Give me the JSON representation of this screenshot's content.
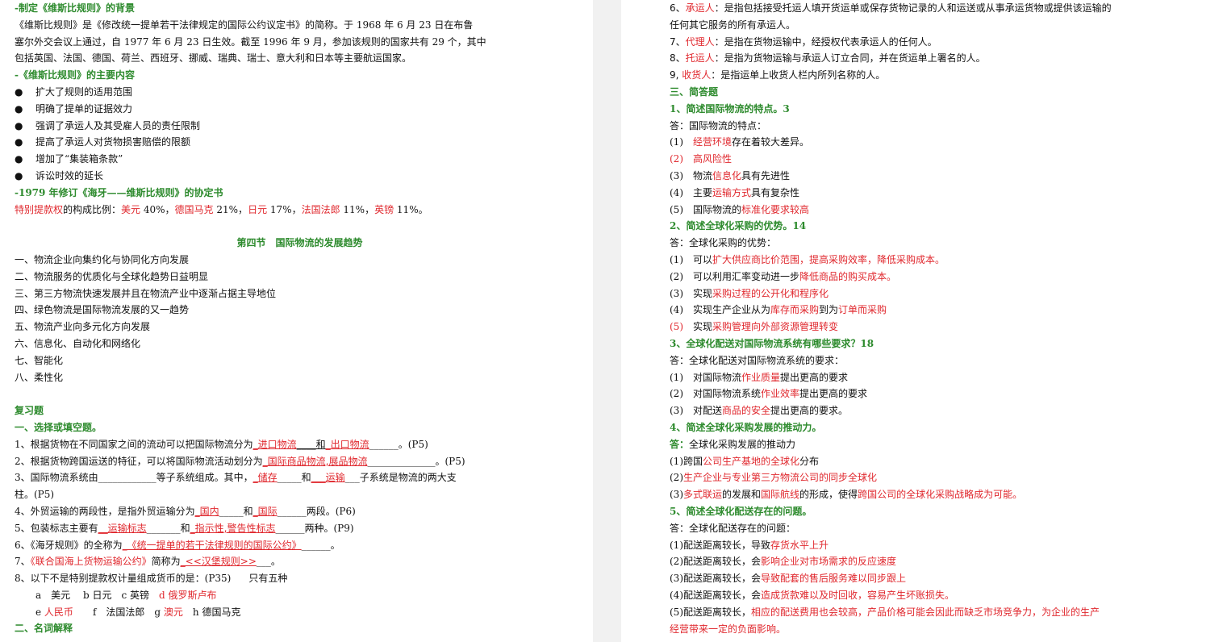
{
  "left": {
    "l1": "-制定《维斯比规则》的背景",
    "l2": "《维斯比规则》是《修改统一提单若干法律规定的国际公约议定书》的简称。于 1968 年 6 月 23 日在布鲁",
    "l3": "塞尔外交会议上通过，自 1977 年 6 月 23 日生效。截至 1996 年 9 月，参加该规则的国家共有 29 个，其中",
    "l4": "包括英国、法国、德国、荷兰、西班牙、挪威、瑞典、瑞士、意大利和日本等主要航运国家。",
    "l5": "-《维斯比规则》的主要内容",
    "bullets": [
      "扩大了规则的适用范围",
      "明确了提单的证据效力",
      "强调了承运人及其受雇人员的责任限制",
      "提高了承运人对货物损害赔偿的限额",
      "增加了“集装箱条款”",
      "诉讼时效的延长"
    ],
    "bullet_symbol": "●",
    "l12": "-1979 年修订《海牙——维斯比规则》的协定书",
    "sdr": {
      "a": "特别提款权",
      "b": "的构成比例：",
      "c": "美元",
      "d": " 40%，",
      "e": "德国马克",
      "f": " 21%，",
      "g": "日元",
      "h": " 17%，",
      "i": "法国法郎",
      "j": " 11%，",
      "k": "英镑",
      "m": " 11%。"
    },
    "section": "第四节　国际物流的发展趋势",
    "trends": [
      "一、物流企业向集约化与协同化方向发展",
      "二、物流服务的优质化与全球化趋势日益明显",
      "三、第三方物流快速发展并且在物流产业中逐渐占据主导地位",
      "四、绿色物流是国际物流发展的又一趋势",
      "五、物流产业向多元化方向发展",
      "六、信息化、自动化和网络化",
      "七、智能化",
      "八、柔性化"
    ],
    "review": "复习题",
    "q_title": "一、选择或填空题。",
    "q1": {
      "a": "1、根据货物在不同国家之间的流动可以把国际物流分为",
      "b": "_进口物流",
      "c": "____和",
      "d": "_出口物流",
      "e": "______。(P5)"
    },
    "q2": {
      "a": "2、根据货物跨国运送的特征，可以将国际物流活动划分为",
      "b": "_国际商品物流,展品物流",
      "c": "______________。(P5)"
    },
    "q3": {
      "a": "3、国际物流系统由____________等子系统组成。其中，",
      "b": "_储存",
      "c": "_____和",
      "d": "___运输",
      "e": "___子系统是物流的两大支"
    },
    "q3b": "柱。(P5)",
    "q4": {
      "a": "4、外贸运输的两段性，是指外贸运输分为",
      "b": "_国内",
      "c": "_____和",
      "d": "_国际",
      "e": "______两段。(P6)"
    },
    "q5": {
      "a": "5、包装标志主要有",
      "b": "__运输标志",
      "c": "_______和",
      "d": "_指示性,警告性标志",
      "e": "______两种。(P9)"
    },
    "q6": {
      "a": "6、《海牙规则》的全称为",
      "b": "_《统一提单的若干法律规则的国际公约》",
      "c": "______。"
    },
    "q7": {
      "a": "7、",
      "b": "《联合国海上货物运输公约》",
      "c": "简称为",
      "d": "_<<汉堡规则>>",
      "e": "___。"
    },
    "q8": {
      "a": "8、以下不是特别提款权计量组成货币的是：(P35)",
      "b": "只有五种"
    },
    "q8o1": {
      "a": "a　美元　 b 日元　c 英镑　",
      "b": "d 俄罗斯卢布"
    },
    "q8o2": {
      "a": "e ",
      "b": "人民币",
      "c": "　　f　法国法郎　g ",
      "d": "澳元",
      "e": "　h 德国马克"
    },
    "terms": "二、名词解释"
  },
  "right": {
    "d6": {
      "a": "6、",
      "b": "承运人",
      "c": "：是指包括接受托运人填开货运单或保存货物记录的人和运送或从事承运货物或提供该运输的"
    },
    "d6b": "任何其它服务的所有承运人。",
    "d7": {
      "a": "7、",
      "b": "代理人",
      "c": "：是指在货物运输中，经授权代表承运人的任何人。"
    },
    "d8": {
      "a": "8、",
      "b": "托运人",
      "c": "：是指为货物运输与承运人订立合同，并在货运单上署名的人。"
    },
    "d9": {
      "a": "9, ",
      "b": "收货人",
      "c": "：是指运单上收货人栏内所列名称的人。"
    },
    "short": "三、简答题",
    "s1": {
      "title": "1、简述国际物流的特点。3",
      "ans": "答：国际物流的特点：",
      "i1": {
        "n": "(1)　",
        "a": "经营环境",
        "b": "存在着较大差异。"
      },
      "i2": {
        "n": "(2)　",
        "a": "高风险性"
      },
      "i3": {
        "n": "(3)　",
        "a": "物流",
        "b": "信息化",
        "c": "具有先进性"
      },
      "i4": {
        "n": "(4)　",
        "a": "主要",
        "b": "运输方式",
        "c": "具有复杂性"
      },
      "i5": {
        "n": "(5)　",
        "a": "国际物流的",
        "b": "标准化要求较高"
      }
    },
    "s2": {
      "title": "2、简述全球化采购的优势。14",
      "ans": "答：全球化采购的优势：",
      "i1": {
        "n": "(1)　",
        "a": "可以",
        "b": "扩大供应商比价范围，提高采购效率，降低采购成本。"
      },
      "i2": {
        "n": "(2)　",
        "a": "可以利用汇率变动进一步",
        "b": "降低商品的购买成本。"
      },
      "i3": {
        "n": "(3)　",
        "a": "实现",
        "b": "采购过程的公开化和程序化"
      },
      "i4": {
        "n": "(4)　",
        "a": "实现生产企业从为",
        "b": "库存而采购",
        "c": "到为",
        "d": "订单而采购"
      },
      "i5": {
        "n": "(5)　",
        "a": "实现",
        "b": "采购管理向外部资源管理转变"
      }
    },
    "s3": {
      "title": "3、全球化配送对国际物流系统有哪些要求？18",
      "ans": "答：全球化配送对国际物流系统的要求：",
      "i1": {
        "n": "(1)　",
        "a": "对国际物流",
        "b": "作业质量",
        "c": "提出更高的要求"
      },
      "i2": {
        "n": "(2)　",
        "a": "对国际物流系统",
        "b": "作业效率",
        "c": "提出更高的要求"
      },
      "i3": {
        "n": "(3)　",
        "a": "对配送",
        "b": "商品的安全",
        "c": "提出更高的要求。"
      }
    },
    "s4": {
      "title": "4、简述全球化采购发展的推动力。",
      "ans_a": "答：",
      "ans_b": "全球化采购发展的推动力",
      "i1": {
        "a": "(1)跨国",
        "b": "公司生产基地的全球化",
        "c": "分布"
      },
      "i2": {
        "a": "(2)",
        "b": "生产企业与专业第三方物流公司的同步全球化"
      },
      "i3": {
        "a": "(3)",
        "b": "多式联运",
        "c": "的发展和",
        "d": "国际航线",
        "e": "的形成，使得",
        "f": "跨国公司的全球化采购战略成为可能。"
      }
    },
    "s5": {
      "title": "5、简述全球化配送存在的问题。",
      "ans": "答：全球化配送存在的问题：",
      "i1": {
        "a": "(1)配送距离较长，导致",
        "b": "存货水平上升"
      },
      "i2": {
        "a": "(2)配送距离较长，会",
        "b": "影响企业对市场需求的反应速度"
      },
      "i3": {
        "a": "(3)配送距离较长，会",
        "b": "导致配套的售后服务难以同步跟上"
      },
      "i4": {
        "a": "(4)配送距离较长，会",
        "b": "造成货款难以及时回收，容易产生坏账损失。"
      },
      "i5": {
        "a": "(5)配送距离较长，",
        "b": "相应的配送费用也会较高，产品价格可能会因此而缺乏市场竞争力，为企业的生产"
      },
      "i5b": "经营带来一定的负面影响。"
    }
  }
}
